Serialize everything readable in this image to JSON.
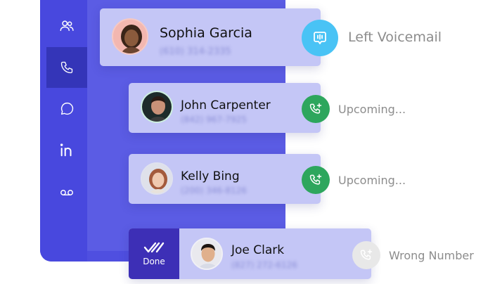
{
  "sidebar": {
    "items": [
      {
        "id": "contacts",
        "icon": "users-icon"
      },
      {
        "id": "calls",
        "icon": "phone-icon",
        "active": true
      },
      {
        "id": "messages",
        "icon": "chat-bubble-icon"
      },
      {
        "id": "linkedin",
        "icon": "linkedin-icon"
      },
      {
        "id": "voicemail",
        "icon": "voicemail-icon"
      }
    ]
  },
  "calls": [
    {
      "name": "Sophia Garcia",
      "phone": "(610) 314-2335",
      "status": "Left Voicemail",
      "status_icon": "voicemail-message-icon",
      "status_color": "#49c3f5"
    },
    {
      "name": "John Carpenter",
      "phone": "(842) 967-7925",
      "status": "Upcoming...",
      "status_icon": "phone-add-icon",
      "status_color": "#2da65d"
    },
    {
      "name": "Kelly Bing",
      "phone": "(200) 346-8126",
      "status": "Upcoming...",
      "status_icon": "phone-add-icon",
      "status_color": "#2da65d"
    },
    {
      "name": "Joe Clark",
      "phone": "(827) 272-6126",
      "status": "Wrong Number",
      "status_icon": "phone-add-icon",
      "status_color": "#e6e6e6"
    }
  ],
  "done": {
    "label": "Done",
    "icon": "double-check-icon"
  }
}
